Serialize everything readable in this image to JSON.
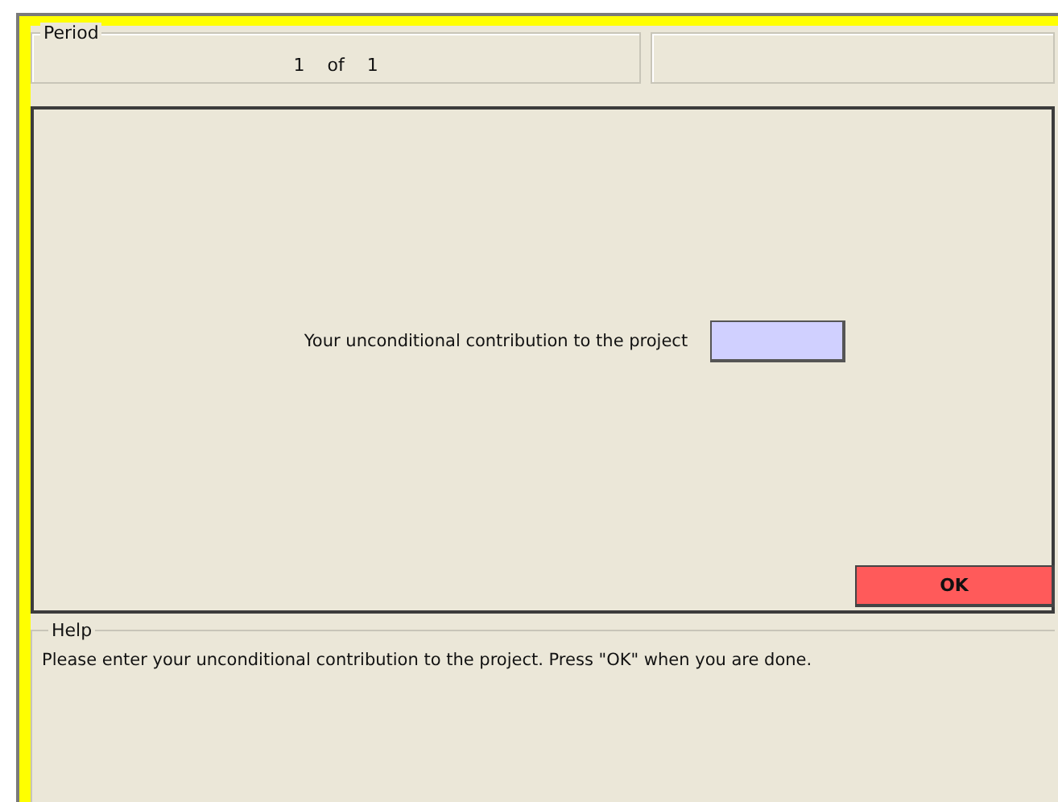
{
  "period": {
    "legend": "Period",
    "current": "1",
    "separator": "of",
    "total": "1"
  },
  "contribution": {
    "label": "Your unconditional contribution to the project"
  },
  "ok_button": {
    "label": "OK"
  },
  "help": {
    "legend": "Help",
    "text": "Please enter your unconditional contribution to the project. Press \"OK\" when you are done."
  }
}
